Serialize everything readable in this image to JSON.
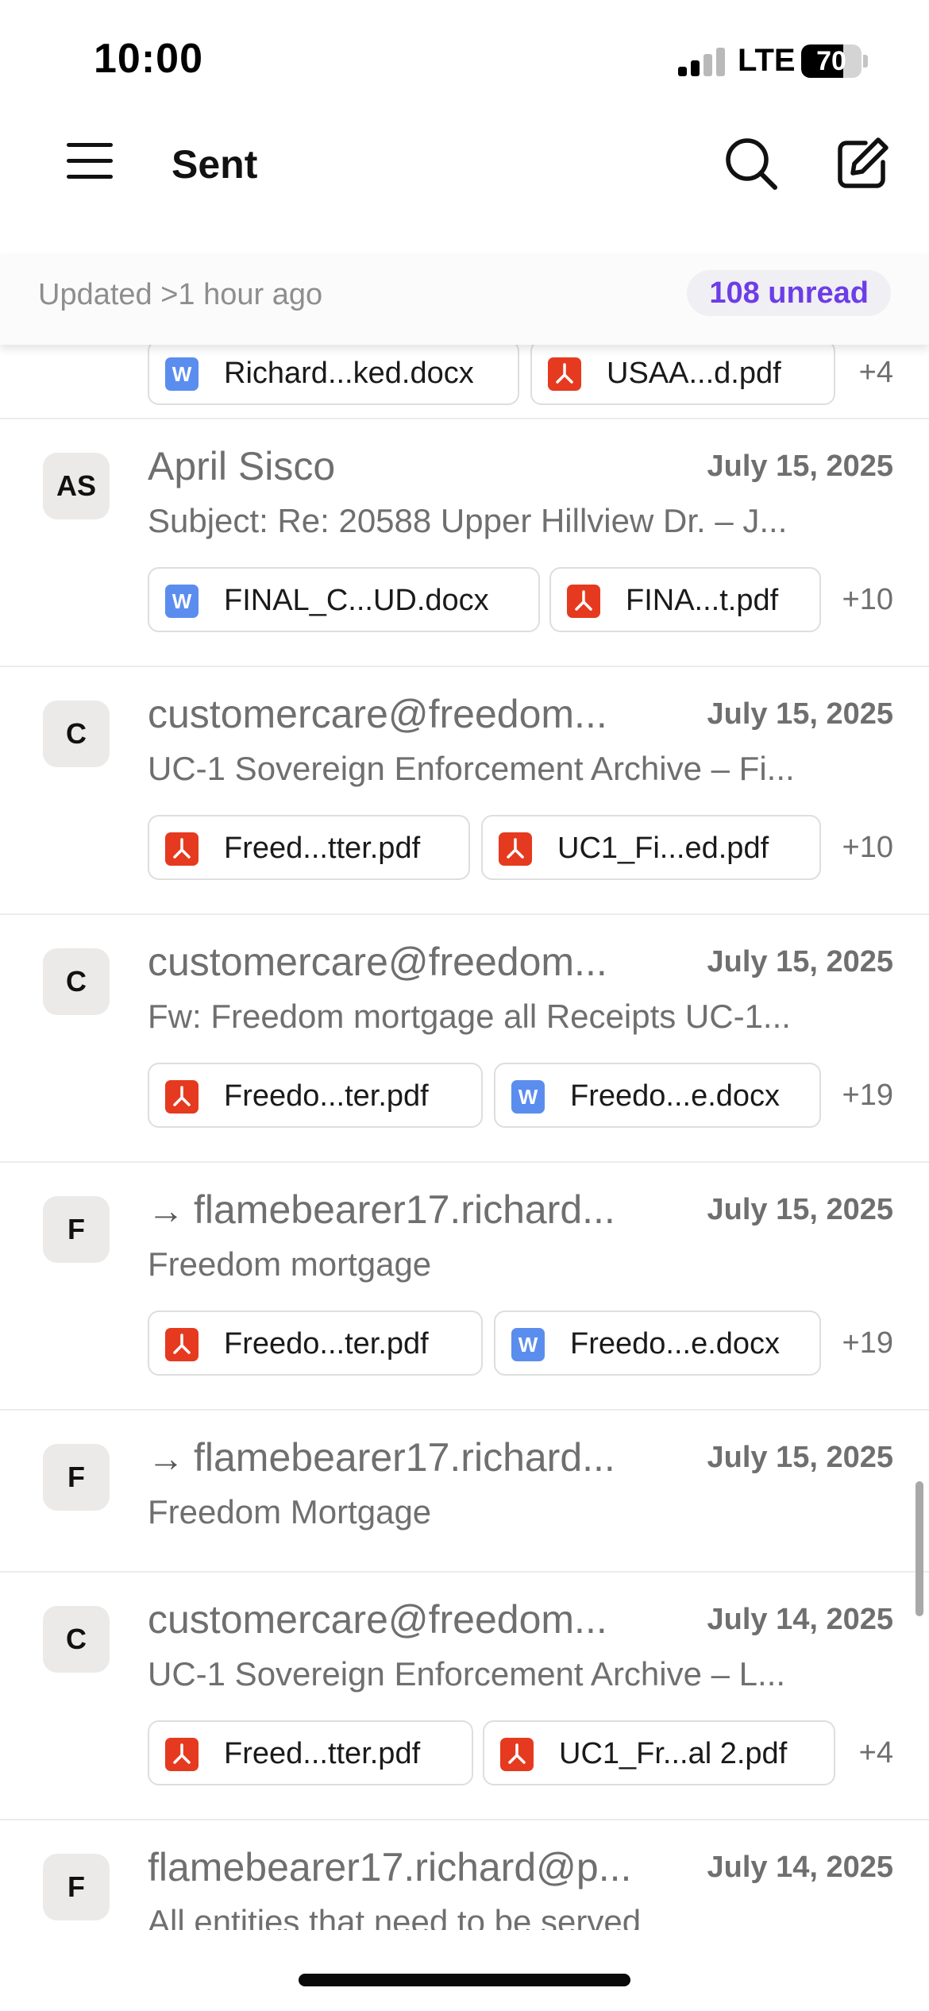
{
  "status_bar": {
    "time": "10:00",
    "network": "LTE",
    "battery": "70",
    "battery_level": 0.7
  },
  "header": {
    "title": "Sent"
  },
  "updated_bar": {
    "text": "Updated >1 hour ago",
    "unread": "108 unread"
  },
  "partial_top": {
    "attachments": [
      {
        "name": "Richard...ked.docx",
        "type": "docx"
      },
      {
        "name": "USAA...d.pdf",
        "type": "pdf"
      }
    ],
    "more": "+4"
  },
  "messages": [
    {
      "initials": "AS",
      "sender": "April Sisco",
      "date": "July 15, 2025",
      "forwarded": false,
      "subject": "Subject: Re: 20588 Upper Hillview Dr. – J...",
      "attachments": [
        {
          "name": "FINAL_C...UD.docx",
          "type": "docx"
        },
        {
          "name": "FINA...t.pdf",
          "type": "pdf"
        }
      ],
      "more": "+10"
    },
    {
      "initials": "C",
      "sender": "customercare@freedom...",
      "date": "July 15, 2025",
      "forwarded": false,
      "subject": "UC-1 Sovereign Enforcement Archive – Fi...",
      "attachments": [
        {
          "name": "Freed...tter.pdf",
          "type": "pdf"
        },
        {
          "name": "UC1_Fi...ed.pdf",
          "type": "pdf"
        }
      ],
      "more": "+10"
    },
    {
      "initials": "C",
      "sender": "customercare@freedom...",
      "date": "July 15, 2025",
      "forwarded": false,
      "subject": "Fw: Freedom mortgage all Receipts UC-1...",
      "attachments": [
        {
          "name": "Freedo...ter.pdf",
          "type": "pdf"
        },
        {
          "name": "Freedo...e.docx",
          "type": "docx"
        }
      ],
      "more": "+19"
    },
    {
      "initials": "F",
      "sender": "flamebearer17.richard...",
      "date": "July 15, 2025",
      "forwarded": true,
      "subject": "Freedom mortgage",
      "attachments": [
        {
          "name": "Freedo...ter.pdf",
          "type": "pdf"
        },
        {
          "name": "Freedo...e.docx",
          "type": "docx"
        }
      ],
      "more": "+19"
    },
    {
      "initials": "F",
      "sender": "flamebearer17.richard...",
      "date": "July 15, 2025",
      "forwarded": true,
      "subject": "Freedom Mortgage",
      "attachments": [],
      "more": ""
    },
    {
      "initials": "C",
      "sender": "customercare@freedom...",
      "date": "July 14, 2025",
      "forwarded": false,
      "subject": "UC-1 Sovereign Enforcement Archive – L...",
      "attachments": [
        {
          "name": "Freed...tter.pdf",
          "type": "pdf"
        },
        {
          "name": "UC1_Fr...al 2.pdf",
          "type": "pdf"
        }
      ],
      "more": "+4"
    },
    {
      "initials": "F",
      "sender": "flamebearer17.richard@p...",
      "date": "July 14, 2025",
      "forwarded": false,
      "subject": "All entities that need to be served",
      "attachments": [],
      "more": ""
    }
  ],
  "icons": {
    "menu": "menu-icon",
    "search": "search-icon",
    "compose": "compose-icon",
    "pdf": "pdf-file-icon",
    "docx": "word-file-icon",
    "forward": "forward-arrow-icon"
  },
  "colors": {
    "accent": "#6d3de6",
    "pdf": "#e53a1f",
    "docx": "#5b8def",
    "badge_bg": "#f0eff4",
    "muted_text": "#6f6f6f"
  }
}
